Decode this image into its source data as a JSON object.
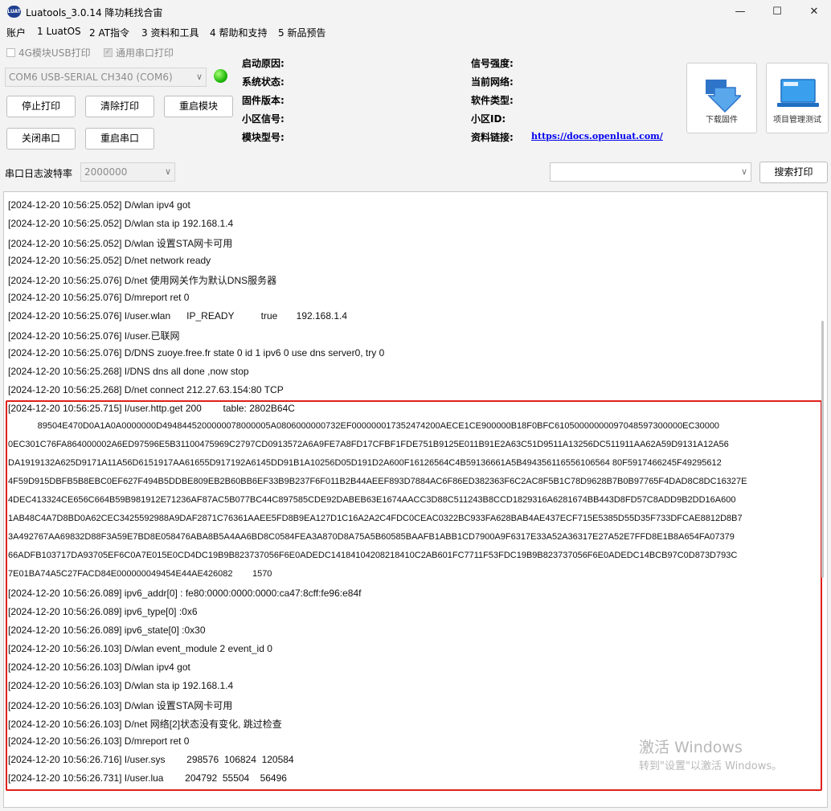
{
  "window": {
    "title": "Luatools_3.0.14 降功耗找合宙",
    "icon_text": "LUAT",
    "min_glyph": "—",
    "max_glyph": "☐",
    "close_glyph": "✕"
  },
  "menu": [
    "账户",
    "1 LuatOS",
    "2 AT指令",
    "3 资料和工具",
    "4 帮助和支持",
    "5 新品预告"
  ],
  "options": {
    "usb_print_label": "4G模块USB打印",
    "usb_print_checked": false,
    "serial_print_label": "通用串口打印",
    "serial_print_checked": true,
    "check_glyph": "✓"
  },
  "port": {
    "value": "COM6 USB-SERIAL CH340 (COM6)",
    "arrow": "∨"
  },
  "buttons": {
    "stop_print": "停止打印",
    "clear_print": "清除打印",
    "restart_module": "重启模块",
    "close_port": "关闭串口",
    "reopen_port": "重启串口",
    "search_print": "搜索打印",
    "download_firmware": "下载固件",
    "project_manage": "项目管理测试"
  },
  "info": {
    "boot_reason": "启动原因:",
    "system_status": "系统状态:",
    "firmware_version": "固件版本:",
    "cell_signal": "小区信号:",
    "module_model": "模块型号:",
    "signal_strength": "信号强度:",
    "current_network": "当前网络:",
    "software_type": "软件类型:",
    "cell_id": "小区ID:",
    "docs_link_label": "资料链接:",
    "docs_link": "https://docs.openluat.com/"
  },
  "baud": {
    "label": "串口日志波特率",
    "value": "2000000",
    "arrow": "∨"
  },
  "search": {
    "value": "",
    "arrow": "∨"
  },
  "log_lines_top": [
    "[2024-12-20 10:56:25.052] D/wlan ipv4 got",
    "[2024-12-20 10:56:25.052] D/wlan sta ip 192.168.1.4",
    "[2024-12-20 10:56:25.052] D/wlan 设置STA网卡可用",
    "[2024-12-20 10:56:25.052] D/net network ready",
    "[2024-12-20 10:56:25.076] D/net 使用网关作为默认DNS服务器",
    "[2024-12-20 10:56:25.076] D/mreport ret 0",
    "[2024-12-20 10:56:25.076] I/user.wlan      IP_READY          true       192.168.1.4",
    "[2024-12-20 10:56:25.076] I/user.已联网",
    "[2024-12-20 10:56:25.076] D/DNS zuoye.free.fr state 0 id 1 ipv6 0 use dns server0, try 0",
    "[2024-12-20 10:56:25.268] I/DNS dns all done ,now stop",
    "[2024-12-20 10:56:25.268] D/net connect 212.27.63.154:80 TCP"
  ],
  "http_header_line": "[2024-12-20 10:56:25.715] I/user.http.get 200        table: 2802B64C",
  "hex_lines": [
    "            89504E470D0A1A0A0000000D4948445200000078000005A0806000000732EF000000017352474200AECE1CE900000B18F0BFC61050000000097048597300000EC30000",
    "0EC301C76FA864000002A6ED97596E5B31100475969C2797CD0913572A6A9FE7A8FD17CFBF1FDE751B9125E011B91E2A63C51D9511A13256DC511911AA62A59D9131A12A56",
    "DA1919132A625D9171A11A56D6151917AA61655D917192A6145DD91B1A10256D05D191D2A600F16126564C4B59136661A5B494356116556106564 80F5917466245F49295612",
    "4F59D915DBFB5B8EBC0EF627F494B5DDBE809EB2B60BB6EF33B9B237F6F011B2B44AEEF893D7884AC6F86ED382363F6C2AC8F5B1C78D9628B7B0B97765F4DAD8C8DC16327E",
    "4DEC413324CE656C664B59B981912E71236AF87AC5B077BC44C897585CDE92DABEB63E1674AACC3D88C511243B8CCD1829316A6281674BB443D8FD57C8ADD9B2DD16A600",
    "1AB48C4A7D8BD0A62CEC3425592988A9DAF2871C76361AAEE5FD8B9EA127D1C16A2A2C4FDC0CEAC0322BC933FA628BAB4AE437ECF715E5385D55D35F733DFCAE8812D8B7",
    "3A492767AA69832D88F3A59E7BD8E058476ABA8B5A4AA6BD8C0584FEA3A870D8A75A5B60585BAAFB1ABB1CD7900A9F6317E33A52A36317E27A52E7FFD8E1B8A654FA07379",
    "66ADFB103717DA93705EF6C0A7E015E0CD4DC19B9B823737056F6E0ADEDC14184104208218410C2AB601FC7711F53FDC19B9B823737056F6E0ADEDC14BCB97C0D873D793C",
    "7E01BA74A5C27FACD84E000000049454E44AE426082        1570"
  ],
  "log_lines_bottom": [
    "[2024-12-20 10:56:26.089] ipv6_addr[0] : fe80:0000:0000:0000:ca47:8cff:fe96:e84f",
    "[2024-12-20 10:56:26.089] ipv6_type[0] :0x6",
    "[2024-12-20 10:56:26.089] ipv6_state[0] :0x30",
    "[2024-12-20 10:56:26.103] D/wlan event_module 2 event_id 0",
    "[2024-12-20 10:56:26.103] D/wlan ipv4 got",
    "[2024-12-20 10:56:26.103] D/wlan sta ip 192.168.1.4",
    "[2024-12-20 10:56:26.103] D/wlan 设置STA网卡可用",
    "[2024-12-20 10:56:26.103] D/net 网络[2]状态没有变化, 跳过检查",
    "[2024-12-20 10:56:26.103] D/mreport ret 0",
    "[2024-12-20 10:56:26.716] I/user.sys        298576  106824  120584",
    "[2024-12-20 10:56:26.731] I/user.lua        204792  55504    56496"
  ],
  "watermark": {
    "line1": "激活 Windows",
    "line2": "转到\"设置\"以激活 Windows。"
  },
  "colors": {
    "highlight": "#e0201c",
    "led": "#21b80a",
    "link": "#0000ee"
  }
}
